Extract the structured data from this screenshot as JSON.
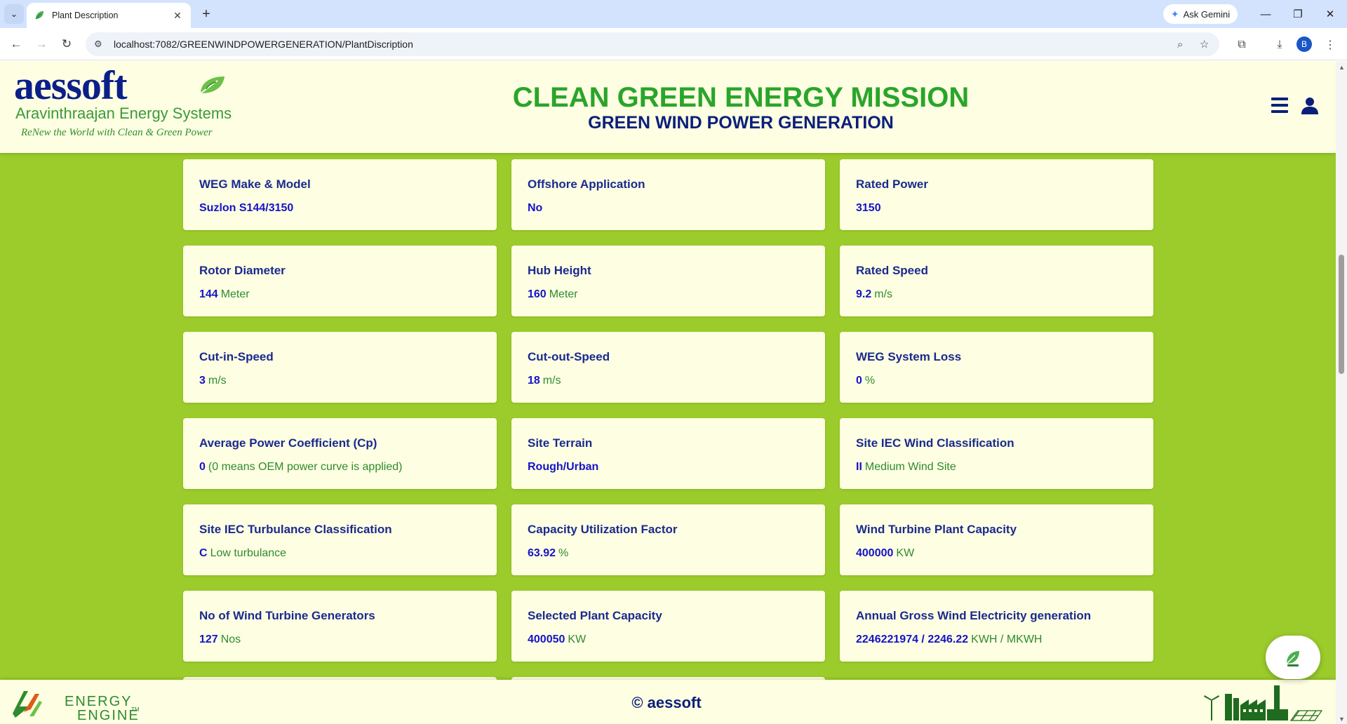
{
  "browser": {
    "tab_title": "Plant Description",
    "new_tab": "+",
    "close_tab": "✕",
    "gemini_label": "Ask Gemini",
    "url": "localhost:7082/GREENWINDPOWERGENERATION/PlantDiscription",
    "profile_initial": "B"
  },
  "header": {
    "logo_word": "aessoft",
    "logo_subtitle": "Aravinthraajan Energy Systems",
    "logo_tagline": "ReNew the World with Clean & Green Power",
    "title": "CLEAN GREEN ENERGY MISSION",
    "subtitle": "GREEN WIND POWER GENERATION"
  },
  "cards": [
    {
      "label": "WEG Make & Model",
      "value": "Suzlon S144/3150",
      "unit": ""
    },
    {
      "label": "Offshore Application",
      "value": "No",
      "unit": ""
    },
    {
      "label": "Rated Power",
      "value": "3150",
      "unit": ""
    },
    {
      "label": "Rotor Diameter",
      "value": "144",
      "unit": "Meter"
    },
    {
      "label": "Hub Height",
      "value": "160",
      "unit": "Meter"
    },
    {
      "label": "Rated Speed",
      "value": "9.2",
      "unit": "m/s"
    },
    {
      "label": "Cut-in-Speed",
      "value": "3",
      "unit": "m/s"
    },
    {
      "label": "Cut-out-Speed",
      "value": "18",
      "unit": "m/s"
    },
    {
      "label": "WEG System Loss",
      "value": "0",
      "unit": "%"
    },
    {
      "label": "Average Power Coefficient (Cp)",
      "value": "0",
      "unit": "(0 means OEM power curve is applied)"
    },
    {
      "label": "Site Terrain",
      "value": "Rough/Urban",
      "unit": ""
    },
    {
      "label": "Site IEC Wind Classification",
      "value": "II",
      "unit": "Medium Wind Site"
    },
    {
      "label": "Site IEC Turbulance Classification",
      "value": "C",
      "unit": "Low turbulance"
    },
    {
      "label": "Capacity Utilization Factor",
      "value": "63.92",
      "unit": "%"
    },
    {
      "label": "Wind Turbine Plant Capacity",
      "value": "400000",
      "unit": "KW"
    },
    {
      "label": "No of Wind Turbine Generators",
      "value": "127",
      "unit": "Nos"
    },
    {
      "label": "Selected Plant Capacity",
      "value": "400050",
      "unit": "KW"
    },
    {
      "label": "Annual Gross Wind Electricity generation",
      "value": "2246221974 / 2246.22",
      "unit": "KWH / MKWH"
    }
  ],
  "footer": {
    "brand_line1": "ENERGY",
    "brand_line2": "ENGINE",
    "brand_tm": "TM",
    "copyright": "© aessoft"
  },
  "colors": {
    "page_green": "#9bcc2b",
    "card_bg": "#fefee2",
    "label_blue": "#1a2a8f",
    "value_blue": "#1414c8",
    "unit_green": "#2e8b2e",
    "title_green": "#2aa52a",
    "subtitle_navy": "#0b1f7a"
  }
}
